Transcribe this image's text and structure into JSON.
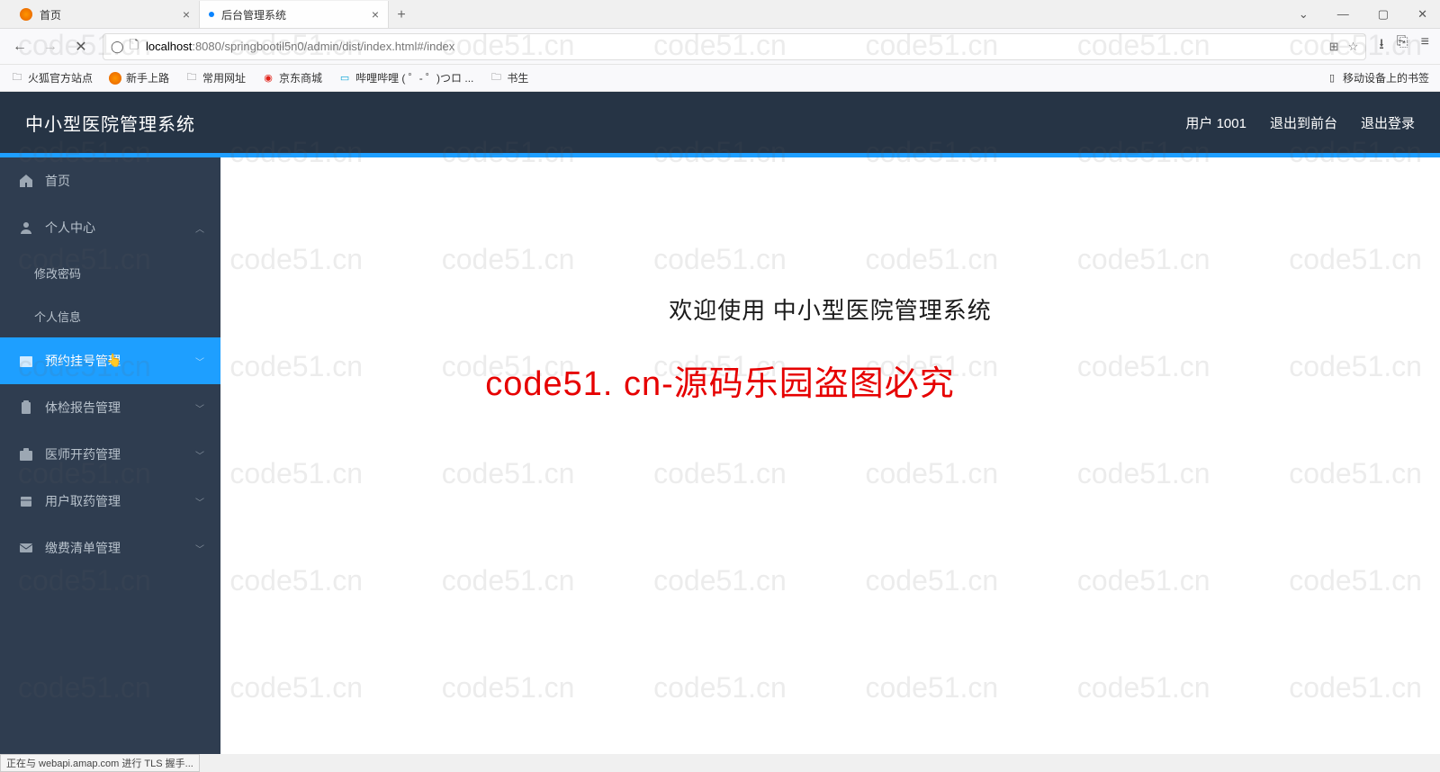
{
  "watermark_text": "code51.cn",
  "watermark_big": "code51. cn-源码乐园盗图必究",
  "browser": {
    "tabs": [
      {
        "title": "首页",
        "favicon": "ff"
      },
      {
        "title": "后台管理系统",
        "favicon": "dot"
      }
    ],
    "window_controls": {
      "min": "—",
      "max": "▢",
      "close": "✕",
      "dropdown": "⌄"
    },
    "nav": {
      "back": "←",
      "forward": "→",
      "stop": "✕"
    },
    "url": {
      "shield": "◯",
      "lock": "🗋",
      "host": "localhost",
      "port_path": ":8080/springbootil5n0/admin/dist/index.html#/index",
      "qr": "⊞",
      "star": "☆"
    },
    "right_icons": {
      "download": "⭳",
      "ext": "⎘",
      "menu": "≡"
    },
    "bookmarks": [
      {
        "icon": "folder",
        "label": "火狐官方站点"
      },
      {
        "icon": "ff",
        "label": "新手上路"
      },
      {
        "icon": "folder",
        "label": "常用网址"
      },
      {
        "icon": "jd",
        "label": "京东商城"
      },
      {
        "icon": "bili",
        "label": "哔哩哔哩 (  ゜- ゜)つロ ..."
      },
      {
        "icon": "folder",
        "label": "书生"
      }
    ],
    "mobile_bookmark": "移动设备上的书签"
  },
  "app": {
    "title": "中小型医院管理系统",
    "user_label": "用户 1001",
    "exit_front": "退出到前台",
    "logout": "退出登录"
  },
  "sidebar": {
    "items": [
      {
        "icon": "home",
        "label": "首页",
        "type": "link"
      },
      {
        "icon": "user",
        "label": "个人中心",
        "type": "expand",
        "arrow": "up"
      },
      {
        "icon": "",
        "label": "修改密码",
        "type": "sub"
      },
      {
        "icon": "",
        "label": "个人信息",
        "type": "sub"
      },
      {
        "icon": "calendar",
        "label": "预约挂号管理",
        "type": "expand",
        "arrow": "down",
        "active": true
      },
      {
        "icon": "clipboard",
        "label": "体检报告管理",
        "type": "expand",
        "arrow": "down"
      },
      {
        "icon": "medkit",
        "label": "医师开药管理",
        "type": "expand",
        "arrow": "down"
      },
      {
        "icon": "box",
        "label": "用户取药管理",
        "type": "expand",
        "arrow": "down"
      },
      {
        "icon": "mail",
        "label": "缴费清单管理",
        "type": "expand",
        "arrow": "down"
      }
    ]
  },
  "main": {
    "welcome": "欢迎使用 中小型医院管理系统"
  },
  "status_bar": "正在与 webapi.amap.com 进行 TLS 握手..."
}
